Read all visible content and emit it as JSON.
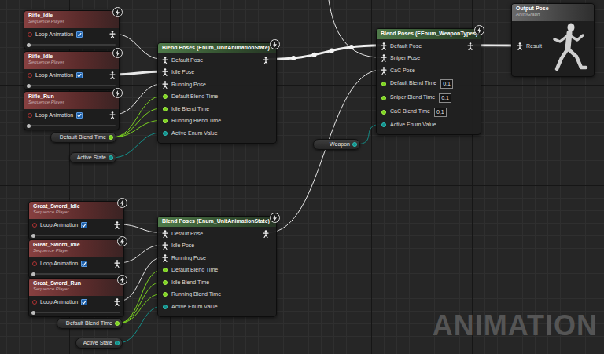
{
  "sequence_players": [
    {
      "title": "Rifle_Idle",
      "subtitle": "Sequence Player",
      "option": "Loop Animation",
      "checked": true
    },
    {
      "title": "Rifle_Idle",
      "subtitle": "Sequence Player",
      "option": "Loop Animation",
      "checked": true
    },
    {
      "title": "Rifle_Run",
      "subtitle": "Sequence Player",
      "option": "Loop Animation",
      "checked": true
    },
    {
      "title": "Great_Sword_Idle",
      "subtitle": "Sequence Player",
      "option": "Loop Animation",
      "checked": true
    },
    {
      "title": "Great_Sword_Idle",
      "subtitle": "Sequence Player",
      "option": "Loop Animation",
      "checked": true
    },
    {
      "title": "Great_Sword_Run",
      "subtitle": "Sequence Player",
      "option": "Loop Animation",
      "checked": true
    }
  ],
  "variables": [
    {
      "label": "Default Blend Time",
      "kind": "float"
    },
    {
      "label": "Active State",
      "kind": "enum"
    },
    {
      "label": "Default Blend Time",
      "kind": "float"
    },
    {
      "label": "Active State",
      "kind": "enum"
    },
    {
      "label": "Weapon",
      "kind": "enum"
    }
  ],
  "blend_nodes": [
    {
      "title": "Blend Poses (Enum_UnitAnimationState)",
      "pins": [
        {
          "label": "Default Pose",
          "kind": "pose"
        },
        {
          "label": "Idle Pose",
          "kind": "pose"
        },
        {
          "label": "Running Pose",
          "kind": "pose"
        },
        {
          "label": "Default Blend Time",
          "kind": "float"
        },
        {
          "label": "Idle Blend Time",
          "kind": "float"
        },
        {
          "label": "Running Blend Time",
          "kind": "float"
        },
        {
          "label": "Active Enum Value",
          "kind": "enum"
        }
      ]
    },
    {
      "title": "Blend Poses (Enum_UnitAnimationState)",
      "pins": [
        {
          "label": "Default Pose",
          "kind": "pose"
        },
        {
          "label": "Idle Pose",
          "kind": "pose"
        },
        {
          "label": "Running Pose",
          "kind": "pose"
        },
        {
          "label": "Default Blend Time",
          "kind": "float"
        },
        {
          "label": "Idle Blend Time",
          "kind": "float"
        },
        {
          "label": "Running Blend Time",
          "kind": "float"
        },
        {
          "label": "Active Enum Value",
          "kind": "enum"
        }
      ]
    },
    {
      "title": "Blend Poses (EEnum_WeaponTypes)",
      "pins": [
        {
          "label": "Default Pose",
          "kind": "pose"
        },
        {
          "label": "Sniper Pose",
          "kind": "pose"
        },
        {
          "label": "CaC Pose",
          "kind": "pose"
        },
        {
          "label": "Default Blend Time",
          "kind": "value",
          "value": "0,1"
        },
        {
          "label": "Sniper Blend Time",
          "kind": "value",
          "value": "0,1"
        },
        {
          "label": "CaC Blend Time",
          "kind": "value",
          "value": "0,1"
        },
        {
          "label": "Active Enum Value",
          "kind": "enum"
        }
      ]
    }
  ],
  "output": {
    "title": "Output Pose",
    "subtitle": "AnimGraph",
    "pin": "Result"
  },
  "watermark": "ANIMATION"
}
